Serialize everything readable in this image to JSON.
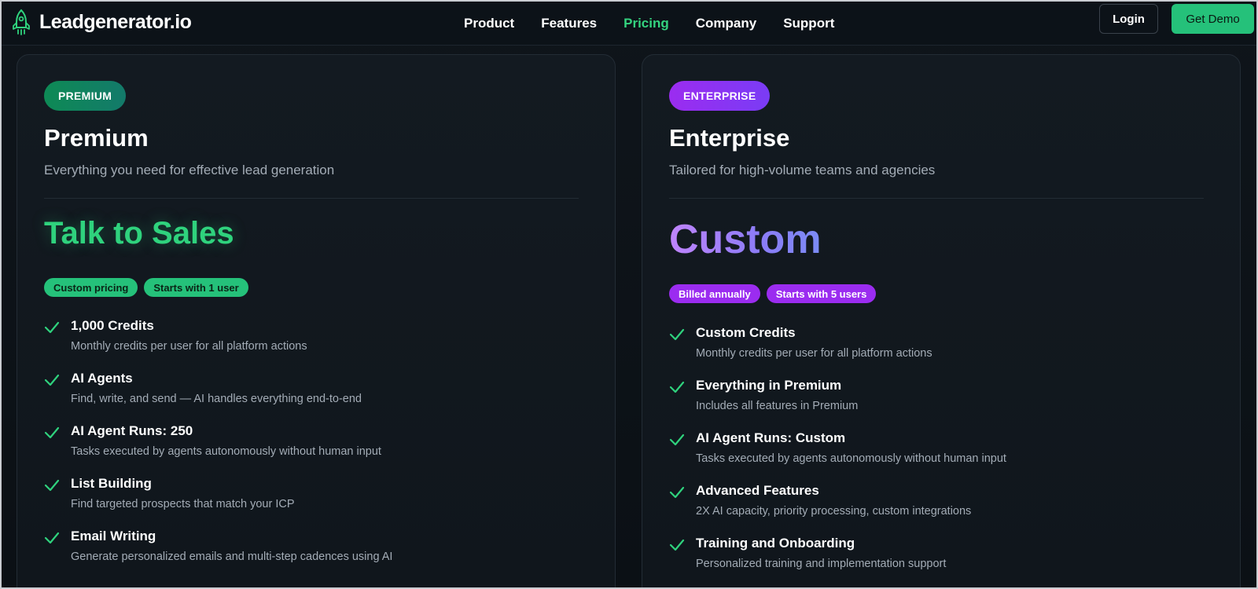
{
  "brand": {
    "name": "Leadgenerator.io",
    "accent": "#2fd27d",
    "purple": "#9b2cf0"
  },
  "nav": {
    "items": [
      {
        "label": "Product",
        "active": false
      },
      {
        "label": "Features",
        "active": false
      },
      {
        "label": "Pricing",
        "active": true
      },
      {
        "label": "Company",
        "active": false
      },
      {
        "label": "Support",
        "active": false
      }
    ],
    "login_label": "Login",
    "demo_label": "Get Demo"
  },
  "plans": [
    {
      "badge": "PREMIUM",
      "name": "Premium",
      "description": "Everything you need for effective lead generation",
      "price": "Talk to Sales",
      "pills": [
        "Custom pricing",
        "Starts with 1 user"
      ],
      "features": [
        {
          "title": "1,000 Credits",
          "desc": "Monthly credits per user for all platform actions"
        },
        {
          "title": "AI Agents",
          "desc": "Find, write, and send — AI handles everything end-to-end"
        },
        {
          "title": "AI Agent Runs: 250",
          "desc": "Tasks executed by agents autonomously without human input"
        },
        {
          "title": "List Building",
          "desc": "Find targeted prospects that match your ICP"
        },
        {
          "title": "Email Writing",
          "desc": "Generate personalized emails and multi-step cadences using AI"
        }
      ]
    },
    {
      "badge": "ENTERPRISE",
      "name": "Enterprise",
      "description": "Tailored for high-volume teams and agencies",
      "price": "Custom",
      "pills": [
        "Billed annually",
        "Starts with 5 users"
      ],
      "features": [
        {
          "title": "Custom Credits",
          "desc": "Monthly credits per user for all platform actions"
        },
        {
          "title": "Everything in Premium",
          "desc": "Includes all features in Premium"
        },
        {
          "title": "AI Agent Runs: Custom",
          "desc": "Tasks executed by agents autonomously without human input"
        },
        {
          "title": "Advanced Features",
          "desc": "2X AI capacity, priority processing, custom integrations"
        },
        {
          "title": "Training and Onboarding",
          "desc": "Personalized training and implementation support"
        }
      ]
    }
  ]
}
